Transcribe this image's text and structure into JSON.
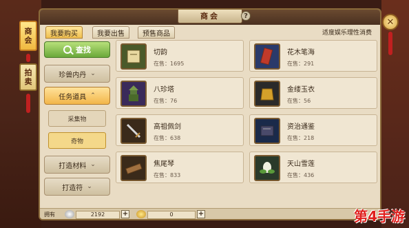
{
  "side_tags": [
    {
      "label_line1": "商",
      "label_line2": "会"
    },
    {
      "label_line1": "拍",
      "label_line2": "卖"
    }
  ],
  "window": {
    "title": "商会"
  },
  "tabs": [
    {
      "label": "我要购买"
    },
    {
      "label": "我要出售"
    },
    {
      "label": "预售商品"
    }
  ],
  "notice": "适度娱乐理性消费",
  "nav": {
    "search_label": "查找",
    "categories": [
      {
        "label": "珍兽内丹",
        "icon": "chevron-down-icon"
      },
      {
        "label": "任务道具",
        "icon": "chevron-up-icon"
      },
      {
        "label": "打造材料",
        "icon": "chevron-down-icon"
      },
      {
        "label": "打造符",
        "icon": "chevron-down-icon"
      }
    ],
    "subitems": [
      {
        "label": "采集物"
      },
      {
        "label": "奇物"
      }
    ]
  },
  "items": [
    {
      "name": "切韵",
      "stock_label": "在售：",
      "stock": "1695",
      "icon": "book-icon",
      "color": "#4a5a2a"
    },
    {
      "name": "花木笔海",
      "stock_label": "在售：",
      "stock": "291",
      "icon": "scroll-icon",
      "color": "#2a3a6a"
    },
    {
      "name": "八珍塔",
      "stock_label": "在售：",
      "stock": "76",
      "icon": "pagoda-icon",
      "color": "#3a2a5a"
    },
    {
      "name": "金缕玉衣",
      "stock_label": "在售：",
      "stock": "56",
      "icon": "armor-icon",
      "color": "#2a2a2a"
    },
    {
      "name": "高祖佩剑",
      "stock_label": "在售：",
      "stock": "638",
      "icon": "sword-icon",
      "color": "#3a2a1a"
    },
    {
      "name": "资治通鉴",
      "stock_label": "在售：",
      "stock": "218",
      "icon": "book-icon",
      "color": "#1a2a4a"
    },
    {
      "name": "焦尾琴",
      "stock_label": "在售：",
      "stock": "833",
      "icon": "zither-icon",
      "color": "#3a2a1a"
    },
    {
      "name": "天山雪莲",
      "stock_label": "在售：",
      "stock": "436",
      "icon": "lotus-icon",
      "color": "#2a3a2a"
    }
  ],
  "footer": {
    "owned_label": "拥有",
    "silver": "2192",
    "gold": "0"
  },
  "watermark": "第4手游"
}
